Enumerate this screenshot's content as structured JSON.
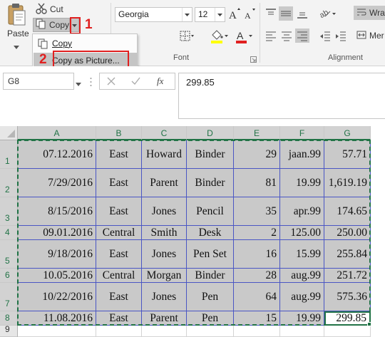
{
  "clipboard": {
    "paste_label": "Paste",
    "cut_label": "Cut",
    "copy_label": "Copy"
  },
  "font": {
    "family": "Georgia",
    "size": "12",
    "group_label": "Font"
  },
  "alignment": {
    "group_label": "Alignment",
    "wrap_label": "Wrap",
    "merge_label": "Mer"
  },
  "copy_menu": {
    "items": [
      {
        "label": "Copy"
      },
      {
        "label": "Copy as Picture..."
      }
    ]
  },
  "annotations": {
    "step1": "1",
    "step2": "2"
  },
  "formula_bar": {
    "name_box": "G8",
    "fx": "fx",
    "value": "299.85"
  },
  "sheet": {
    "columns": [
      "A",
      "B",
      "C",
      "D",
      "E",
      "F",
      "G"
    ],
    "rows": [
      {
        "num": "1",
        "cells": [
          "07.12.2016",
          "East",
          "Howard",
          "Binder",
          "29",
          "jaan.99",
          "57.71"
        ]
      },
      {
        "num": "2",
        "cells": [
          "7/29/2016",
          "East",
          "Parent",
          "Binder",
          "81",
          "19.99",
          "1,619.19"
        ]
      },
      {
        "num": "3",
        "cells": [
          "8/15/2016",
          "East",
          "Jones",
          "Pencil",
          "35",
          "apr.99",
          "174.65"
        ]
      },
      {
        "num": "4",
        "cells": [
          "09.01.2016",
          "Central",
          "Smith",
          "Desk",
          "2",
          "125.00",
          "250.00"
        ]
      },
      {
        "num": "5",
        "cells": [
          "9/18/2016",
          "East",
          "Jones",
          "Pen Set",
          "16",
          "15.99",
          "255.84"
        ]
      },
      {
        "num": "6",
        "cells": [
          "10.05.2016",
          "Central",
          "Morgan",
          "Binder",
          "28",
          "aug.99",
          "251.72"
        ]
      },
      {
        "num": "7",
        "cells": [
          "10/22/2016",
          "East",
          "Jones",
          "Pen",
          "64",
          "aug.99",
          "575.36"
        ]
      },
      {
        "num": "8",
        "cells": [
          "11.08.2016",
          "East",
          "Parent",
          "Pen",
          "15",
          "19.99",
          "299.85"
        ]
      },
      {
        "num": "9",
        "cells": [
          "",
          "",
          "",
          "",
          "",
          "",
          ""
        ]
      }
    ]
  },
  "colors": {
    "accent_green": "#217346",
    "annotation_red": "#e02020",
    "cell_border": "#4a56c4",
    "selected_fill": "#c9c9c9"
  }
}
